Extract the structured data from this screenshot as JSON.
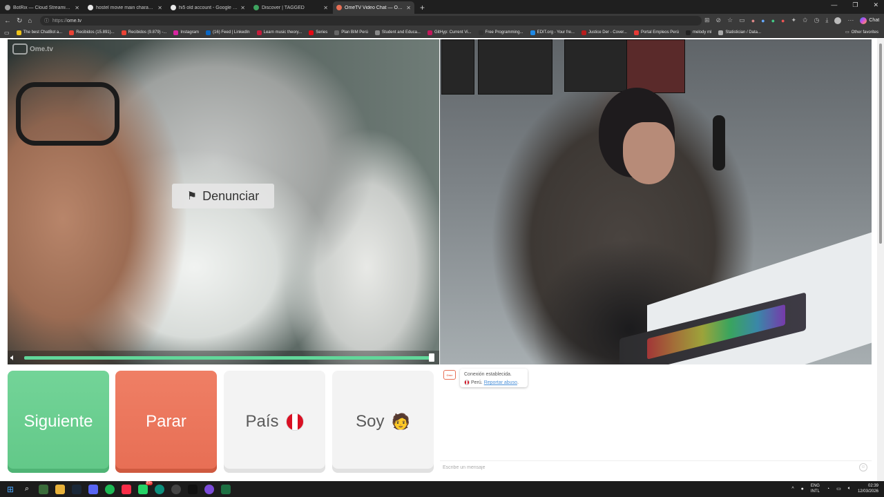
{
  "browser": {
    "tabs": [
      {
        "title": "BotRix — Cloud Streaming Bo",
        "favicon_color": "#9b9b9b",
        "active": false
      },
      {
        "title": "hostel movie main character - Go",
        "favicon_color": "#e8e8e8",
        "active": false
      },
      {
        "title": "hi5 old account - Google Search",
        "favicon_color": "#e8e8e8",
        "active": false
      },
      {
        "title": "Discover | TAGGED",
        "favicon_color": "#3ea35f",
        "active": false
      },
      {
        "title": "OmeTV Video Chat — Omeg",
        "favicon_color": "#e76e54",
        "active": true
      }
    ],
    "new_tab": "+",
    "url_protocol": "https://",
    "url_host": "ome.tv",
    "chat_label": "Chat",
    "bookmarks": [
      {
        "label": "The best ChatBot a...",
        "color": "#f0c419"
      },
      {
        "label": "Recibidos (15.891)...",
        "color": "#ea4335"
      },
      {
        "label": "Recibidos (9.879) -...",
        "color": "#ea4335"
      },
      {
        "label": "Instagram",
        "color": "#d6249f"
      },
      {
        "label": "(16) Feed | LinkedIn",
        "color": "#0a66c2"
      },
      {
        "label": "Learn music theory...",
        "color": "#c41c3b"
      },
      {
        "label": "Series",
        "color": "#e50914"
      },
      {
        "label": "Plan BIM Perú",
        "color": "#666666"
      },
      {
        "label": "Student and Educa...",
        "color": "#888888"
      },
      {
        "label": "GitHyp: Current Vi...",
        "color": "#c2185b"
      },
      {
        "label": "Free Programming...",
        "color": "#333333"
      },
      {
        "label": "EDIT.org - Your fre...",
        "color": "#1e88e5"
      },
      {
        "label": "Justice Der - Cover...",
        "color": "#b71c1c"
      },
      {
        "label": "Portal Empleos Perú",
        "color": "#e53935"
      },
      {
        "label": "melody ml",
        "color": "#222222"
      },
      {
        "label": "Statistician / Data...",
        "color": "#aaaaaa"
      }
    ],
    "other_favorites": "Other favorites"
  },
  "video": {
    "logo_text": "Ome.tv",
    "report_label": "Denunciar",
    "volume_level_pct": 100
  },
  "controls": {
    "next_label": "Siguiente",
    "stop_label": "Parar",
    "country_label": "País",
    "iam_label": "Soy",
    "iam_emoji": "🧑"
  },
  "chat": {
    "messages": [
      {
        "line1": "Conexión establecida.",
        "country": "Perú.",
        "report_link": "Reportar abuso"
      }
    ],
    "input_placeholder": "Escribe un mensaje"
  },
  "taskbar": {
    "lang_line1": "ENG",
    "lang_line2": "INTL",
    "time": "02:39",
    "date": "12/03/2026",
    "notification_badge": "99+"
  },
  "colors": {
    "next_green": "#62c888",
    "stop_red": "#e76e54",
    "volume_green": "#61d79a",
    "peru_red": "#d91023"
  }
}
